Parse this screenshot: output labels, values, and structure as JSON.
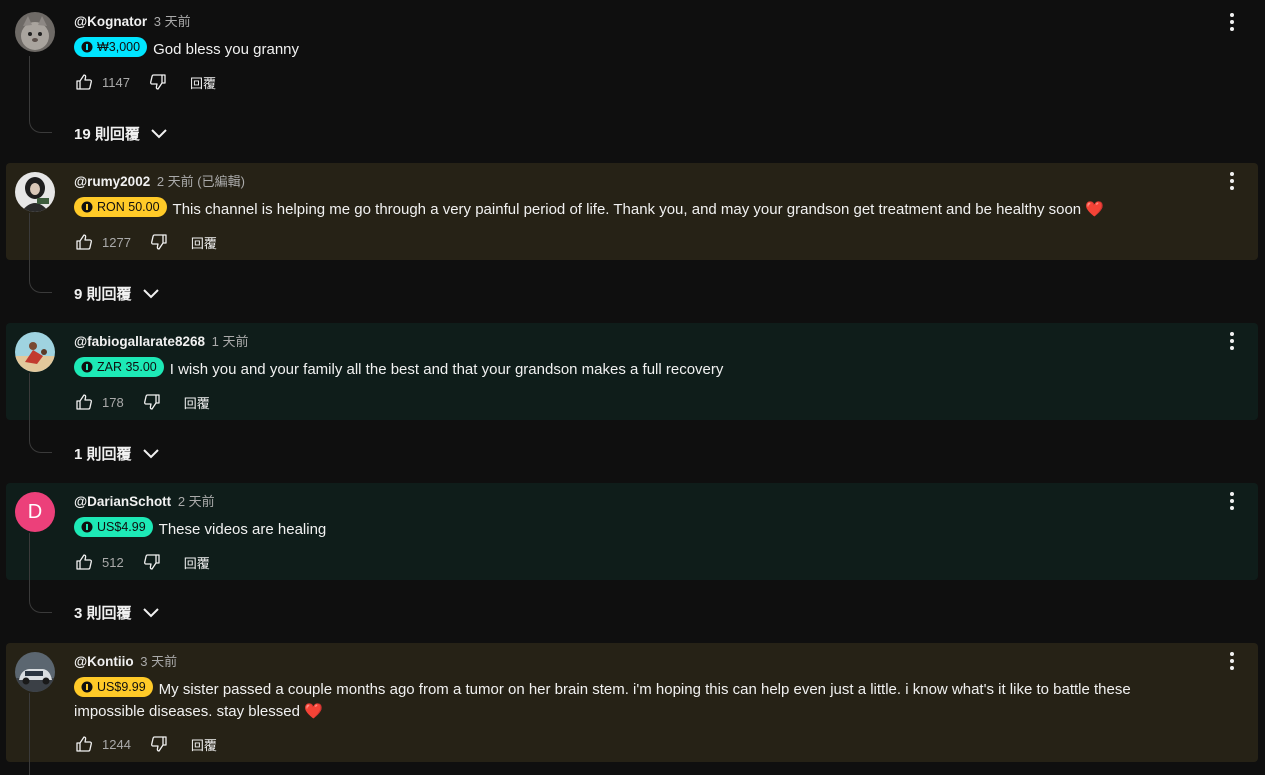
{
  "colors": {
    "page_bg": "#0f0f0f",
    "highlight_gold": "#262216",
    "highlight_teal": "#0f1d1a",
    "chip_cyan": "#00e5ff",
    "chip_yellow": "#ffca28",
    "chip_green": "#1de9b6",
    "heart": "#e3342f"
  },
  "comments": [
    {
      "author": "@Kognator",
      "time": "3 天前",
      "chip": "₩3,000",
      "chip_color": "#00e5ff",
      "text": "God bless you granny",
      "likes": "1147",
      "reply_label": "回覆",
      "replies_label": "19 則回覆",
      "avatar": "cat-photo"
    },
    {
      "author": "@rumy2002",
      "time": "2 天前 (已編輯)",
      "chip": "RON 50.00",
      "chip_color": "#ffca28",
      "text": "This channel is helping me go through a very painful period of life. Thank you, and may your grandson get treatment and be healthy soon",
      "heart": "❤️",
      "likes": "1277",
      "reply_label": "回覆",
      "replies_label": "9 則回覆",
      "avatar": "person-photo"
    },
    {
      "author": "@fabiogallarate8268",
      "time": "1 天前",
      "chip": "ZAR 35.00",
      "chip_color": "#1de9b6",
      "text": "I wish you and your family all the best and that your grandson makes a full recovery",
      "likes": "178",
      "reply_label": "回覆",
      "replies_label": "1 則回覆",
      "avatar": "beach-photo"
    },
    {
      "author": "@DarianSchott",
      "time": "2 天前",
      "chip": "US$4.99",
      "chip_color": "#1de9b6",
      "text": "These videos are healing",
      "likes": "512",
      "reply_label": "回覆",
      "replies_label": "3 則回覆",
      "avatar_letter": "D"
    },
    {
      "author": "@Kontiio",
      "time": "3 天前",
      "chip": "US$9.99",
      "chip_color": "#ffca28",
      "text_line1": "My sister passed a couple months ago from a tumor on her brain stem. i'm hoping this can help even just a little. i know what's it like to battle these",
      "text_line2": "impossible diseases. stay blessed",
      "heart": "❤️",
      "likes": "1244",
      "reply_label": "回覆",
      "avatar": "car-photo"
    }
  ]
}
